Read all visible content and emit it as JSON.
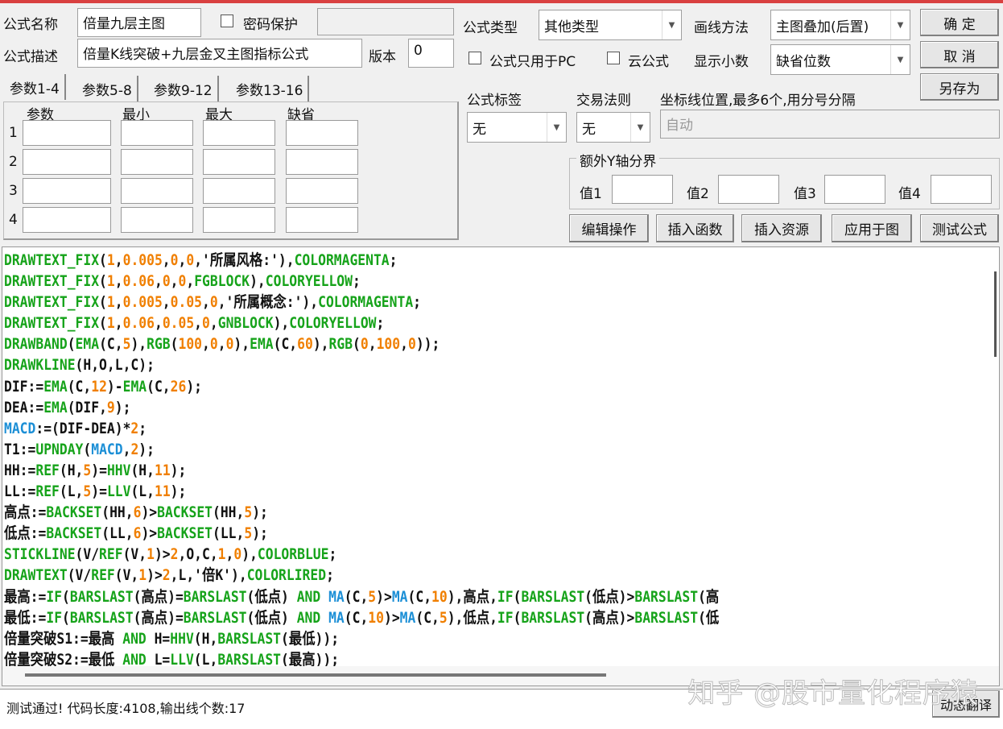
{
  "form": {
    "name_label": "公式名称",
    "name_value": "倍量九层主图",
    "password_label": "密码保护",
    "password_value": "",
    "desc_label": "公式描述",
    "desc_value": "倍量K线突破+九层金叉主图指标公式",
    "version_label": "版本",
    "version_value": "0",
    "type_label": "公式类型",
    "type_value": "其他类型",
    "draw_label": "画线方法",
    "draw_value": "主图叠加(后置)",
    "pc_only_label": "公式只用于PC",
    "cloud_label": "云公式",
    "decimals_label": "显示小数",
    "decimals_value": "缺省位数",
    "tag_label": "公式标签",
    "tag_value": "无",
    "rule_label": "交易法则",
    "rule_value": "无",
    "axis_label": "坐标线位置,最多6个,用分号分隔",
    "axis_placeholder": "自动",
    "extra_y_label": "额外Y轴分界",
    "extra_y": [
      "值1",
      "值2",
      "值3",
      "值4"
    ]
  },
  "buttons": {
    "ok": "确 定",
    "cancel": "取 消",
    "save_as": "另存为",
    "edit": "编辑操作",
    "insert_func": "插入函数",
    "insert_res": "插入资源",
    "apply": "应用于图",
    "test": "测试公式",
    "translate": "动态翻译"
  },
  "params": {
    "tabs": [
      "参数1-4",
      "参数5-8",
      "参数9-12",
      "参数13-16"
    ],
    "headers": [
      "参数",
      "最小",
      "最大",
      "缺省"
    ],
    "rows": [
      "1",
      "2",
      "3",
      "4"
    ]
  },
  "code_lines": [
    "{g:DRAWTEXT_FIX}({o:1},{o:0.005},{o:0},{o:0},'所属风格:'),{g:COLORMAGENTA};",
    "{g:DRAWTEXT_FIX}({o:1},{o:0.06},{o:0},{o:0},{g:FGBLOCK}),{g:COLORYELLOW};",
    "{g:DRAWTEXT_FIX}({o:1},{o:0.005},{o:0.05},{o:0},'所属概念:'),{g:COLORMAGENTA};",
    "{g:DRAWTEXT_FIX}({o:1},{o:0.06},{o:0.05},{o:0},{g:GNBLOCK}),{g:COLORYELLOW};",
    "{g:DRAWBAND}({g:EMA}(C,{o:5}),{g:RGB}({o:100},{o:0},{o:0}),{g:EMA}(C,{o:60}),{g:RGB}({o:0},{o:100},{o:0}));",
    "{g:DRAWKLINE}(H,O,L,C);",
    "DIF:={g:EMA}(C,{o:12})-{g:EMA}(C,{o:26});",
    "DEA:={g:EMA}(DIF,{o:9});",
    "{b:MACD}:=(DIF-DEA)*{o:2};",
    "T1:={g:UPNDAY}({b:MACD},{o:2});",
    "HH:={g:REF}(H,{o:5})={g:HHV}(H,{o:11});",
    "LL:={g:REF}(L,{o:5})={g:LLV}(L,{o:11});",
    "高点:={g:BACKSET}(HH,{o:6})>{g:BACKSET}(HH,{o:5});",
    "低点:={g:BACKSET}(LL,{o:6})>{g:BACKSET}(LL,{o:5});",
    "{g:STICKLINE}(V/{g:REF}(V,{o:1})>{o:2},O,C,{o:1},{o:0}),{g:COLORBLUE};",
    "{g:DRAWTEXT}(V/{g:REF}(V,{o:1})>{o:2},L,'倍K'),{g:COLORLIRED};",
    "最高:={g:IF}({g:BARSLAST}(高点)={g:BARSLAST}(低点) {g:AND} {b:MA}(C,{o:5})>{b:MA}(C,{o:10}),高点,{g:IF}({g:BARSLAST}(低点)>{g:BARSLAST}(高",
    "最低:={g:IF}({g:BARSLAST}(高点)={g:BARSLAST}(低点) {g:AND} {b:MA}(C,{o:10})>{b:MA}(C,{o:5}),低点,{g:IF}({g:BARSLAST}(高点)>{g:BARSLAST}(低",
    "倍量突破S1:=最高 {g:AND} H={g:HHV}(H,{g:BARSLAST}(最低));",
    "倍量突破S2:=最低 {g:AND} L={g:LLV}(L,{g:BARSLAST}(最高));"
  ],
  "status_text": "测试通过! 代码长度:4108,输出线个数:17",
  "watermark": "知乎 @股市量化程序猿"
}
